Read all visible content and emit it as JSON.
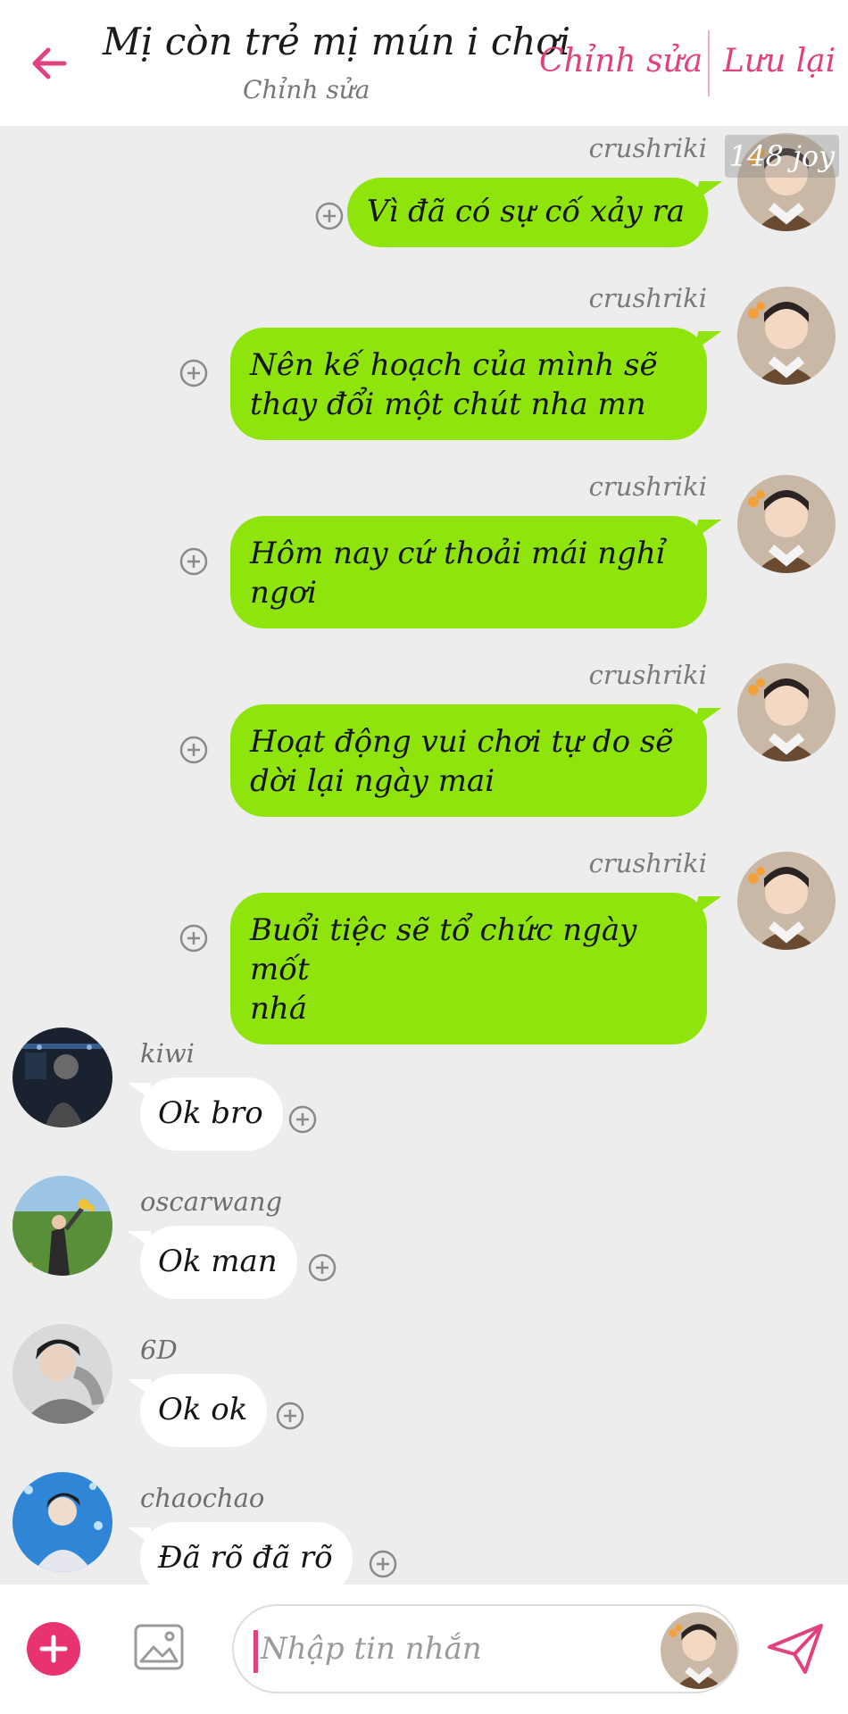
{
  "header": {
    "title": "Mị còn trẻ mị mún i chơi",
    "subtitle": "Chỉnh sửa",
    "edit_label": "Chỉnh sửa",
    "save_label": "Lưu lại"
  },
  "counter": "148 joy",
  "outgoing": [
    {
      "username": "crushriki",
      "lines": [
        "Vì đã có sự cố xảy ra"
      ]
    },
    {
      "username": "crushriki",
      "lines": [
        "Nên kế hoạch của mình sẽ",
        "thay đổi một chút nha mn"
      ]
    },
    {
      "username": "crushriki",
      "lines": [
        "Hôm nay cứ thoải mái nghỉ",
        "ngơi"
      ]
    },
    {
      "username": "crushriki",
      "lines": [
        "Hoạt động vui chơi tự do sẽ",
        "dời lại ngày mai"
      ]
    },
    {
      "username": "crushriki",
      "lines": [
        "Buổi tiệc sẽ tổ chức ngày mốt",
        "nhá"
      ]
    }
  ],
  "incoming": [
    {
      "username": "kiwi",
      "text": "Ok bro"
    },
    {
      "username": "oscarwang",
      "text": "Ok man"
    },
    {
      "username": "6D",
      "text": "Ok ok"
    },
    {
      "username": "chaochao",
      "text": "Đã rõ đã rõ"
    }
  ],
  "composer": {
    "placeholder": "Nhập tin nhắn"
  },
  "colors": {
    "accent": "#e0417f",
    "outgoing_bubble": "#8fe40b",
    "incoming_bubble": "#ffffff",
    "background": "#ededed"
  },
  "icons": [
    "back-arrow-icon",
    "add-circle-icon",
    "plus-icon",
    "image-icon",
    "send-icon"
  ]
}
